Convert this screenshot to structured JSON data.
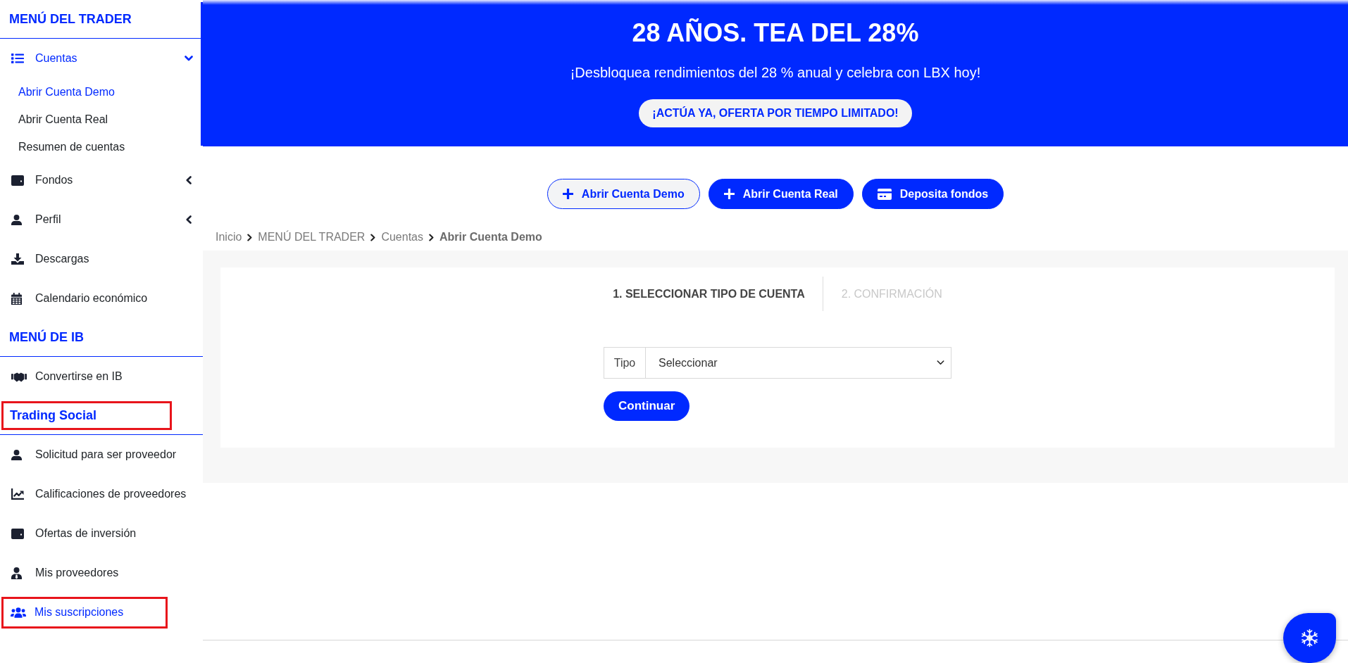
{
  "sidebar": {
    "sections": [
      {
        "title": "MENÚ DEL TRADER",
        "highlighted": false,
        "items": [
          {
            "label": "Cuentas",
            "kind": "group",
            "expanded": true,
            "selected": true,
            "highlighted": false,
            "children": [
              {
                "label": "Abrir Cuenta Demo",
                "selected": true
              },
              {
                "label": "Abrir Cuenta Real",
                "selected": false
              },
              {
                "label": "Resumen de cuentas",
                "selected": false
              }
            ]
          },
          {
            "label": "Fondos",
            "kind": "group",
            "expanded": false,
            "selected": false,
            "highlighted": false
          },
          {
            "label": "Perfil",
            "kind": "group",
            "expanded": false,
            "selected": false,
            "highlighted": false
          },
          {
            "label": "Descargas",
            "kind": "link",
            "selected": false,
            "highlighted": false
          },
          {
            "label": "Calendario económico",
            "kind": "link",
            "selected": false,
            "highlighted": false
          }
        ]
      },
      {
        "title": "MENÚ DE IB",
        "highlighted": false,
        "items": [
          {
            "label": "Convertirse en IB",
            "kind": "link",
            "selected": false,
            "highlighted": false
          }
        ]
      },
      {
        "title": "Trading Social",
        "highlighted": true,
        "items": [
          {
            "label": "Solicitud para ser proveedor",
            "kind": "link",
            "selected": false,
            "highlighted": false
          },
          {
            "label": "Calificaciones de proveedores",
            "kind": "link",
            "selected": false,
            "highlighted": false
          },
          {
            "label": "Ofertas de inversión",
            "kind": "link",
            "selected": false,
            "highlighted": false
          },
          {
            "label": "Mis proveedores",
            "kind": "link",
            "selected": false,
            "highlighted": false
          },
          {
            "label": "Mis suscripciones",
            "kind": "link",
            "selected": true,
            "highlighted": true
          }
        ]
      }
    ]
  },
  "banner": {
    "title": "28 AÑOS. TEA DEL 28%",
    "subtitle": "¡Desbloquea rendimientos del 28 % anual y celebra con LBX hoy!",
    "cta": "¡ACTÚA YA, OFERTA POR TIEMPO LIMITADO!"
  },
  "actions": [
    {
      "label": "Abrir Cuenta Demo",
      "selected": true
    },
    {
      "label": "Abrir Cuenta Real",
      "selected": false
    },
    {
      "label": "Deposita fondos",
      "selected": false
    }
  ],
  "breadcrumb": [
    "Inicio",
    "MENÚ DEL TRADER",
    "Cuentas",
    "Abrir Cuenta Demo"
  ],
  "steps": [
    {
      "label": "1. SELECCIONAR TIPO DE CUENTA",
      "selected": true
    },
    {
      "label": "2. CONFIRMACIÓN",
      "selected": false
    }
  ],
  "form": {
    "field_label": "Tipo",
    "select_value": "Seleccionar",
    "submit": "Continuar"
  }
}
